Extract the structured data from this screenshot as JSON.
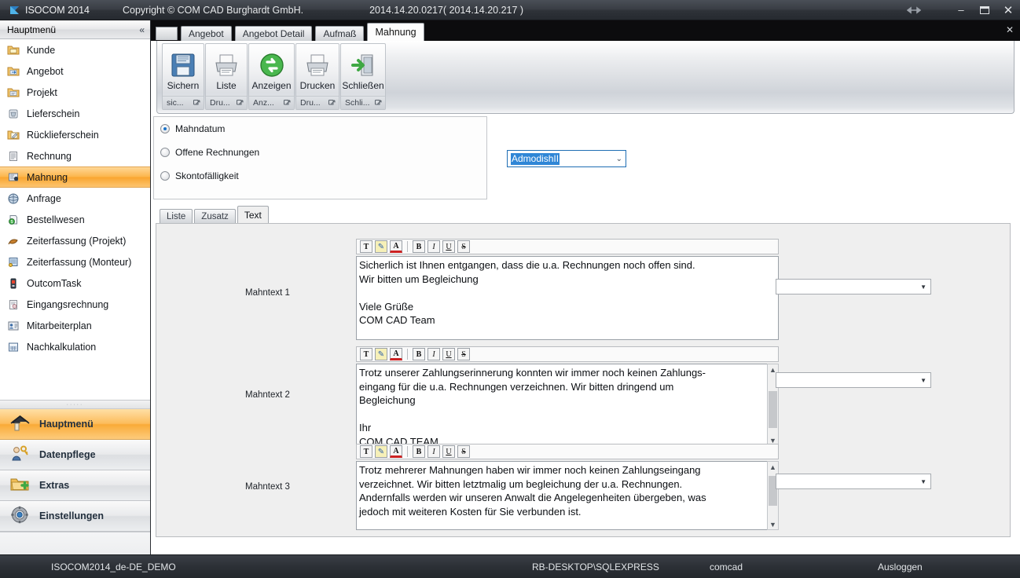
{
  "titlebar": {
    "app_icon": "flag-icon",
    "title": "ISOCOM 2014",
    "copyright": "Copyright © COM CAD Burghardt GmbH.",
    "version": "2014.14.20.0217( 2014.14.20.217 )",
    "resize_icon": "resize-handle-icon",
    "minimize": "–",
    "maximize": "❐",
    "close": "✕"
  },
  "sidebar": {
    "header": {
      "title": "Hauptmenü",
      "collapse_icon": "«"
    },
    "items": [
      {
        "label": "Kunde",
        "icon": "folder-mail-icon",
        "active": false
      },
      {
        "label": "Angebot",
        "icon": "folder-arrow-icon",
        "active": false
      },
      {
        "label": "Projekt",
        "icon": "folder-note-icon",
        "active": false
      },
      {
        "label": "Lieferschein",
        "icon": "delivery-icon",
        "active": false
      },
      {
        "label": "Rücklieferschein",
        "icon": "return-delivery-icon",
        "active": false
      },
      {
        "label": "Rechnung",
        "icon": "invoice-icon",
        "active": false
      },
      {
        "label": "Mahnung",
        "icon": "reminder-icon",
        "active": true
      },
      {
        "label": "Anfrage",
        "icon": "request-icon",
        "active": false
      },
      {
        "label": "Bestellwesen",
        "icon": "order-money-icon",
        "active": false
      },
      {
        "label": "Zeiterfassung (Projekt)",
        "icon": "time-project-icon",
        "active": false
      },
      {
        "label": "Zeiterfassung (Monteur)",
        "icon": "time-fitter-icon",
        "active": false
      },
      {
        "label": "OutcomTask",
        "icon": "task-icon",
        "active": false
      },
      {
        "label": "Eingangsrechnung",
        "icon": "incoming-invoice-icon",
        "active": false
      },
      {
        "label": "Mitarbeiterplan",
        "icon": "employee-plan-icon",
        "active": false
      },
      {
        "label": "Nachkalkulation",
        "icon": "costing-icon",
        "active": false
      }
    ],
    "grip": "·····",
    "nav": [
      {
        "label": "Hauptmenü",
        "icon": "home-icon",
        "active": true
      },
      {
        "label": "Datenpflege",
        "icon": "user-key-icon",
        "active": false
      },
      {
        "label": "Extras",
        "icon": "folder-plus-icon",
        "active": false
      },
      {
        "label": "Einstellungen",
        "icon": "gear-icon",
        "active": false
      }
    ],
    "tail_arrow": "▼"
  },
  "tabstrip": {
    "tabs": [
      {
        "label": "Angebot",
        "active": false
      },
      {
        "label": "Angebot Detail",
        "active": false
      },
      {
        "label": "Aufmaß",
        "active": false
      },
      {
        "label": "Mahnung",
        "active": true
      }
    ],
    "close_icon": "✕"
  },
  "ribbon": {
    "groups": [
      {
        "label": "Sichern",
        "icon": "save-floppy-icon",
        "footer": "sic...",
        "dialog_icon": "dialog-launcher-icon"
      },
      {
        "label": "Liste",
        "icon": "printer-icon",
        "footer": "Dru...",
        "dialog_icon": "dialog-launcher-icon"
      },
      {
        "label": "Anzeigen",
        "icon": "refresh-green-icon",
        "footer": "Anz...",
        "dialog_icon": "dialog-launcher-icon"
      },
      {
        "label": "Drucken",
        "icon": "printer-icon",
        "footer": "Dru...",
        "dialog_icon": "dialog-launcher-icon"
      },
      {
        "label": "Schließen",
        "icon": "exit-door-icon",
        "footer": "Schli...",
        "dialog_icon": "dialog-launcher-icon"
      }
    ]
  },
  "options": {
    "radios": [
      {
        "label": "Mahndatum",
        "selected": true
      },
      {
        "label": "Offene Rechnungen",
        "selected": false
      },
      {
        "label": "Skontofälligkeit",
        "selected": false
      }
    ],
    "combo": {
      "value": "AdmodishII",
      "arrow": "⌄"
    }
  },
  "inner_tabs": [
    {
      "label": "Liste",
      "active": false
    },
    {
      "label": "Zusatz",
      "active": false
    },
    {
      "label": "Text",
      "active": true
    }
  ],
  "editor_toolbar": {
    "buttons": [
      {
        "name": "font-icon",
        "glyph": "T"
      },
      {
        "name": "highlight-icon",
        "glyph": "✎"
      },
      {
        "name": "font-color-icon",
        "glyph": "A"
      },
      {
        "name": "bold-icon",
        "glyph": "B"
      },
      {
        "name": "italic-icon",
        "glyph": "I"
      },
      {
        "name": "underline-icon",
        "glyph": "U"
      },
      {
        "name": "strikethrough-icon",
        "glyph": "S"
      }
    ]
  },
  "mahntexte": [
    {
      "label": "Mahntext 1",
      "text": "Sicherlich ist Ihnen entgangen, dass die u.a. Rechnungen noch offen sind.\nWir bitten um Begleichung\n\nViele Grüße\nCOM CAD Team",
      "scrollbar": false,
      "combo_value": ""
    },
    {
      "label": "Mahntext 2",
      "text": "Trotz unserer Zahlungserinnerung konnten wir immer noch keinen Zahlungs-\neingang für die u.a. Rechnungen verzeichnen. Wir bitten dringend um\nBegleichung\n\nIhr\nCOM CAD TEAM",
      "scrollbar": true,
      "combo_value": ""
    },
    {
      "label": "Mahntext 3",
      "text": "Trotz mehrerer Mahnungen haben wir immer noch keinen Zahlungseingang\nverzeichnet. Wir bitten letztmalig um begleichung der u.a. Rechnungen.\nAndernfalls werden wir unseren Anwalt die Angelegenheiten übergeben, was\njedoch mit weiteren Kosten für Sie verbunden ist.",
      "scrollbar": true,
      "combo_value": ""
    }
  ],
  "statusbar": {
    "database": "ISOCOM2014_de-DE_DEMO",
    "server": "RB-DESKTOP\\SQLEXPRESS",
    "user": "comcad",
    "logout": "Ausloggen"
  },
  "colors": {
    "accent_orange": "#f9a52f",
    "titlebar_dark": "#2e3238",
    "selection_blue": "#2f86d6",
    "panel_gray": "#efefef"
  }
}
